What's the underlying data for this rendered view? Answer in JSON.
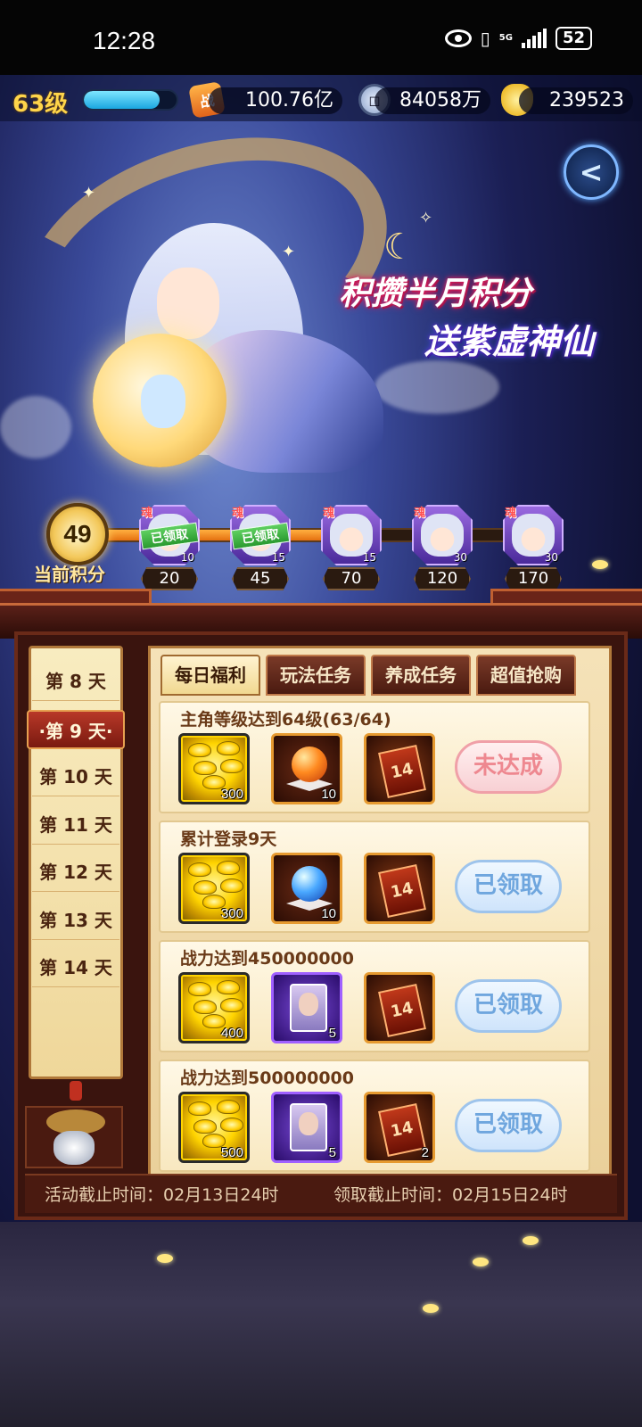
{
  "status_bar": {
    "time": "12:28",
    "network": "5G",
    "battery": "52"
  },
  "header": {
    "level": "63级",
    "exp_fraction": 0.82,
    "power_label": "战",
    "power": "100.76亿",
    "coins": "84058万",
    "gold": "239523"
  },
  "banner": {
    "slogan_line1": "积攒半月积分",
    "slogan_line2": "送紫虚神仙"
  },
  "progress": {
    "current_score": "49",
    "current_score_label": "当前积分",
    "fill_fraction": 0.5,
    "milestones": [
      {
        "threshold": "20",
        "count": "10",
        "soul": "魂",
        "claimed_label": "已领取",
        "claimed": true
      },
      {
        "threshold": "45",
        "count": "15",
        "soul": "魂",
        "claimed_label": "已领取",
        "claimed": true
      },
      {
        "threshold": "70",
        "count": "15",
        "soul": "魂",
        "claimed_label": "",
        "claimed": false
      },
      {
        "threshold": "120",
        "count": "30",
        "soul": "魂",
        "claimed_label": "",
        "claimed": false
      },
      {
        "threshold": "170",
        "count": "30",
        "soul": "魂",
        "claimed_label": "",
        "claimed": false
      }
    ]
  },
  "days": [
    "第 8 天",
    "·第 9 天·",
    "第 10 天",
    "第 11 天",
    "第 12 天",
    "第 13 天",
    "第 14 天"
  ],
  "tabs": [
    "每日福利",
    "玩法任务",
    "养成任务",
    "超值抢购"
  ],
  "tasks": [
    {
      "title": "主角等级达到64级(63/64)",
      "rewards": [
        {
          "type": "gold",
          "qty": "300"
        },
        {
          "type": "orb-red",
          "qty": "10"
        },
        {
          "type": "ticket",
          "qty": ""
        }
      ],
      "button": "未达成",
      "status": "pending"
    },
    {
      "title": "累计登录9天",
      "rewards": [
        {
          "type": "gold",
          "qty": "300"
        },
        {
          "type": "orb-blue",
          "qty": "10"
        },
        {
          "type": "ticket",
          "qty": ""
        }
      ],
      "button": "已领取",
      "status": "claimed"
    },
    {
      "title": "战力达到450000000",
      "rewards": [
        {
          "type": "gold",
          "qty": "400"
        },
        {
          "type": "card",
          "qty": "5"
        },
        {
          "type": "ticket",
          "qty": ""
        }
      ],
      "button": "已领取",
      "status": "claimed"
    },
    {
      "title": "战力达到500000000",
      "rewards": [
        {
          "type": "gold",
          "qty": "500"
        },
        {
          "type": "card",
          "qty": "5"
        },
        {
          "type": "ticket",
          "qty": "2"
        }
      ],
      "button": "已领取",
      "status": "claimed"
    }
  ],
  "ticket_glyph": "14",
  "footer": {
    "activity_deadline": "活动截止时间：02月13日24时",
    "claim_deadline": "领取截止时间：02月15日24时"
  },
  "colors": {
    "accent_gold": "#ffd54a",
    "pending_text": "#ee8890",
    "claimed_text": "#6fa6de"
  }
}
